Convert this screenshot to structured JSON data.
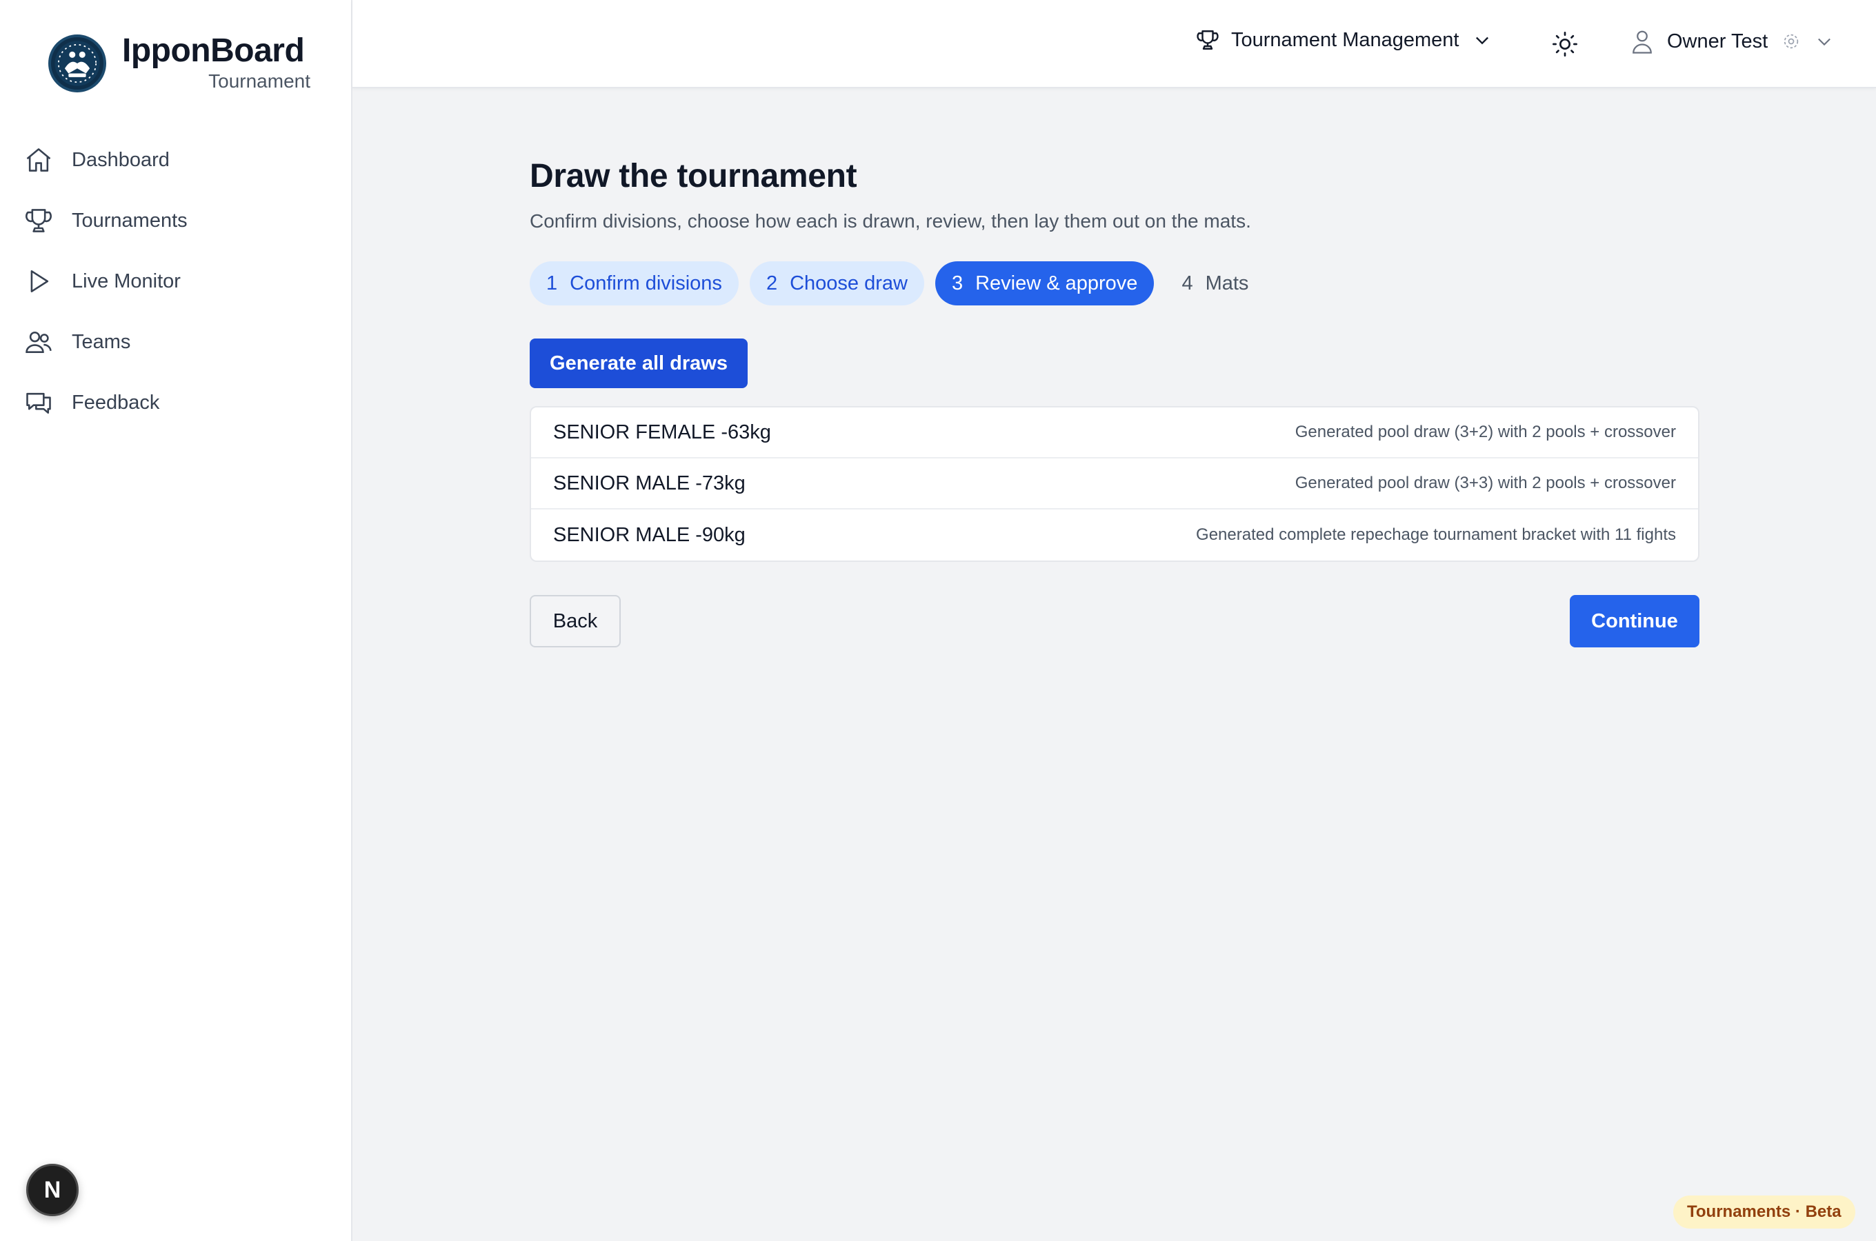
{
  "brand": {
    "title": "IpponBoard",
    "subtitle": "Tournament"
  },
  "sidebar": {
    "items": [
      {
        "label": "Dashboard",
        "icon": "home-icon"
      },
      {
        "label": "Tournaments",
        "icon": "trophy-icon"
      },
      {
        "label": "Live Monitor",
        "icon": "play-icon"
      },
      {
        "label": "Teams",
        "icon": "users-icon"
      },
      {
        "label": "Feedback",
        "icon": "chat-icon"
      }
    ],
    "dev_badge": "N"
  },
  "header": {
    "context_menu": "Tournament Management",
    "user_name": "Owner Test"
  },
  "main": {
    "title": "Draw the tournament",
    "subtitle": "Confirm divisions, choose how each is drawn, review, then lay them out on the mats.",
    "steps": [
      {
        "num": "1",
        "label": "Confirm divisions",
        "state": "done"
      },
      {
        "num": "2",
        "label": "Choose draw",
        "state": "done"
      },
      {
        "num": "3",
        "label": "Review & approve",
        "state": "active"
      },
      {
        "num": "4",
        "label": "Mats",
        "state": "todo"
      }
    ],
    "generate_label": "Generate all draws",
    "draws": [
      {
        "name": "SENIOR FEMALE -63kg",
        "status": "Generated pool draw (3+2) with 2 pools + crossover"
      },
      {
        "name": "SENIOR MALE -73kg",
        "status": "Generated pool draw (3+3) with 2 pools + crossover"
      },
      {
        "name": "SENIOR MALE -90kg",
        "status": "Generated complete repechage tournament bracket with 11 fights"
      }
    ],
    "back_label": "Back",
    "continue_label": "Continue"
  },
  "footer_badge": "Tournaments · Beta",
  "colors": {
    "accent": "#2563eb",
    "accent_dark": "#1d4ed8",
    "step_done_bg": "#dbeafe",
    "beta_bg": "#fef3c7"
  }
}
